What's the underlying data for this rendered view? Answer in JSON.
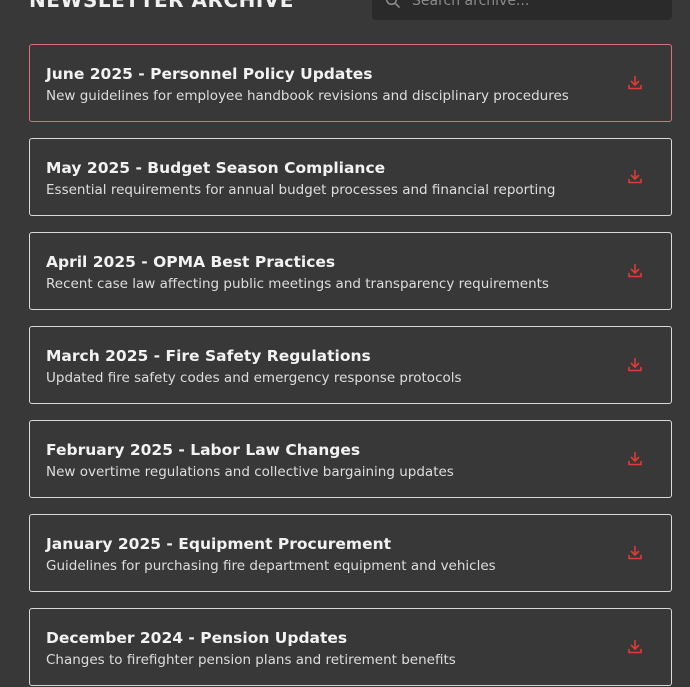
{
  "header": {
    "title": "NEWSLETTER ARCHIVE",
    "search_placeholder": "Search archive..."
  },
  "accent_color": "#e53935",
  "active_border_color": "#d9707a",
  "newsletters": [
    {
      "title": "June 2025 - Personnel Policy Updates",
      "description": "New guidelines for employee handbook revisions and disciplinary procedures",
      "icon": "download-icon"
    },
    {
      "title": "May 2025 - Budget Season Compliance",
      "description": "Essential requirements for annual budget processes and financial reporting",
      "icon": "download-icon"
    },
    {
      "title": "April 2025 - OPMA Best Practices",
      "description": "Recent case law affecting public meetings and transparency requirements",
      "icon": "download-icon"
    },
    {
      "title": "March 2025 - Fire Safety Regulations",
      "description": "Updated fire safety codes and emergency response protocols",
      "icon": "download-icon"
    },
    {
      "title": "February 2025 - Labor Law Changes",
      "description": "New overtime regulations and collective bargaining updates",
      "icon": "download-icon"
    },
    {
      "title": "January 2025 - Equipment Procurement",
      "description": "Guidelines for purchasing fire department equipment and vehicles",
      "icon": "download-icon"
    },
    {
      "title": "December 2024 - Pension Updates",
      "description": "Changes to firefighter pension plans and retirement benefits",
      "icon": "download-icon"
    }
  ]
}
